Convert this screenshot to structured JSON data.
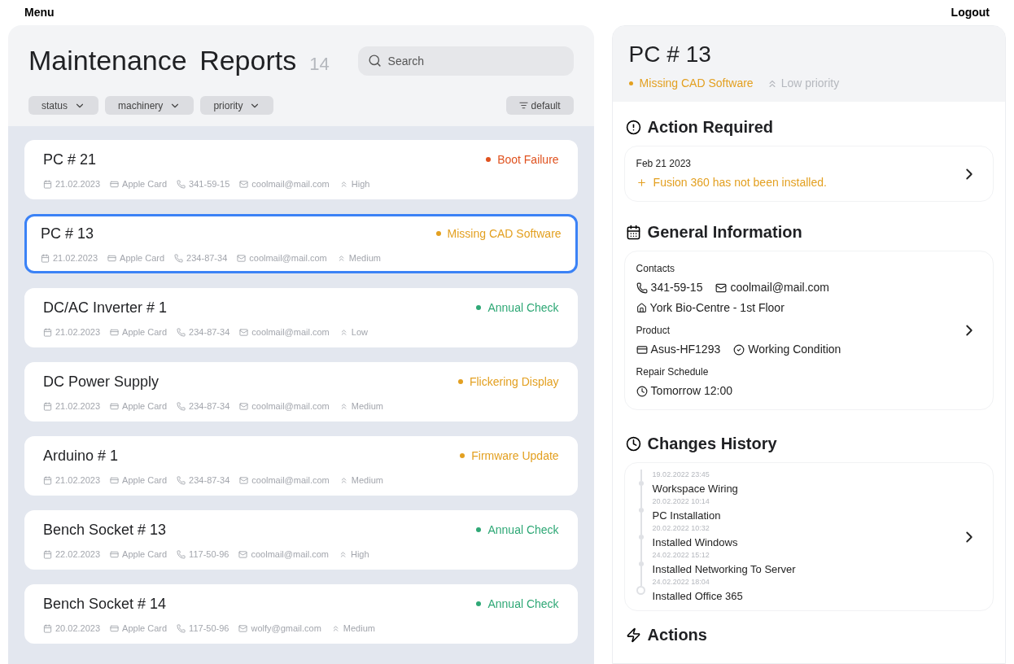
{
  "top_bar": {
    "menu": "Menu",
    "logout": "Logout"
  },
  "list": {
    "title": "Maintenance Reports",
    "count": "14",
    "search": {
      "placeholder": "Search"
    },
    "filters": [
      "status",
      "machinery",
      "priority"
    ],
    "sort": "default",
    "reports": [
      {
        "name": "PC # 21",
        "status": "Boot Failure",
        "color": "#e0521f",
        "date": "21.02.2023",
        "payment": "Apple Card",
        "phone": "341-59-15",
        "email": "coolmail@mail.com",
        "priority": "High",
        "selected": false
      },
      {
        "name": "PC # 13",
        "status": "Missing CAD Software",
        "color": "#e3a021",
        "date": "21.02.2023",
        "payment": "Apple Card",
        "phone": "234-87-34",
        "email": "coolmail@mail.com",
        "priority": "Medium",
        "selected": true
      },
      {
        "name": "DC/AC Inverter # 1",
        "status": "Annual Check",
        "color": "#2fa876",
        "date": "21.02.2023",
        "payment": "Apple Card",
        "phone": "234-87-34",
        "email": "coolmail@mail.com",
        "priority": "Low",
        "selected": false
      },
      {
        "name": "DC Power Supply",
        "status": "Flickering Display",
        "color": "#e3a021",
        "date": "21.02.2023",
        "payment": "Apple Card",
        "phone": "234-87-34",
        "email": "coolmail@mail.com",
        "priority": "Medium",
        "selected": false
      },
      {
        "name": "Arduino # 1",
        "status": "Firmware Update",
        "color": "#e3a021",
        "date": "21.02.2023",
        "payment": "Apple Card",
        "phone": "234-87-34",
        "email": "coolmail@mail.com",
        "priority": "Medium",
        "selected": false
      },
      {
        "name": "Bench Socket # 13",
        "status": "Annual Check",
        "color": "#2fa876",
        "date": "22.02.2023",
        "payment": "Apple Card",
        "phone": "117-50-96",
        "email": "coolmail@mail.com",
        "priority": "High",
        "selected": false
      },
      {
        "name": "Bench Socket # 14",
        "status": "Annual Check",
        "color": "#2fa876",
        "date": "20.02.2023",
        "payment": "Apple Card",
        "phone": "117-50-96",
        "email": "wolfy@gmail.com",
        "priority": "Medium",
        "selected": false
      }
    ]
  },
  "detail": {
    "title": "PC # 13",
    "status": "Missing CAD Software",
    "color": "#e3a021",
    "priority": "Low priority",
    "action_required": {
      "heading": "Action Required",
      "date": "Feb 21 2023",
      "message": "Fusion 360 has not been installed."
    },
    "general_information": {
      "heading": "General Information",
      "contacts_label": "Contacts",
      "phone": "341-59-15",
      "email": "coolmail@mail.com",
      "location": "York Bio-Centre - 1st Floor",
      "product_label": "Product",
      "product": "Asus-HF1293",
      "condition": "Working Condition",
      "schedule_label": "Repair Schedule",
      "schedule": "Tomorrow 12:00"
    },
    "changes_history": {
      "heading": "Changes History",
      "entries": [
        {
          "time": "19.02.2022 23:45",
          "title": "Workspace Wiring",
          "kind": "past"
        },
        {
          "time": "20.02.2022 10:14",
          "title": "PC Installation",
          "kind": "past"
        },
        {
          "time": "20.02.2022 10:32",
          "title": "Installed Windows",
          "kind": "past"
        },
        {
          "time": "24.02.2022 15:12",
          "title": "Installed Networking To Server",
          "kind": "past"
        },
        {
          "time": "24.02.2022 18:04",
          "title": "Installed Office 365",
          "kind": "latest"
        }
      ]
    },
    "actions": {
      "heading": "Actions"
    }
  }
}
